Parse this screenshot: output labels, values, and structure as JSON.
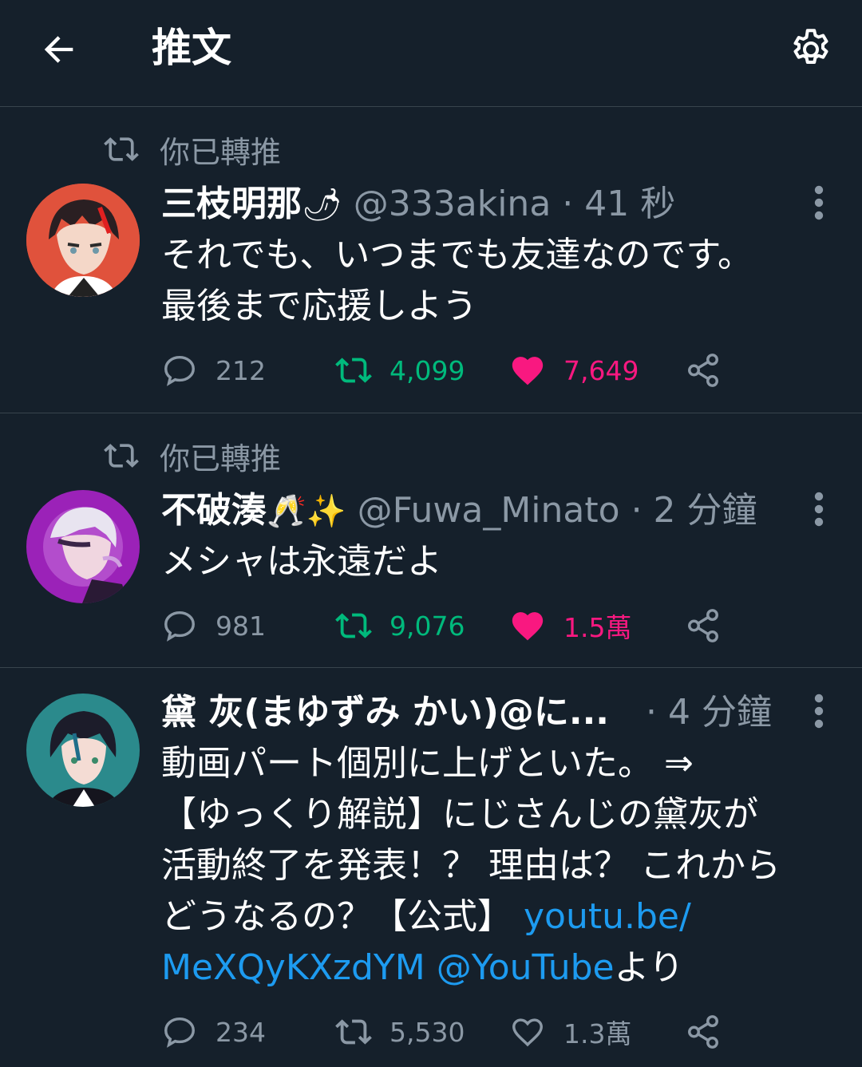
{
  "header": {
    "title": "推文"
  },
  "tweets": [
    {
      "retweet_label": "你已轉推",
      "name": "三枝明那",
      "emoji": "🌶",
      "handle": "@333akina",
      "time": "· 41 秒",
      "text": "それでも、いつまでも友達なのです。\n最後まで応援しよう",
      "replies": "212",
      "retweets": "4,099",
      "likes": "7,649",
      "retweeted": true,
      "liked": true
    },
    {
      "retweet_label": "你已轉推",
      "name": "不破湊",
      "emoji": "🥂✨",
      "handle": "@Fuwa_Minato",
      "time": "· 2 分鐘",
      "text": "メシャは永遠だよ",
      "replies": "981",
      "retweets": "9,076",
      "likes": "1.5萬",
      "retweeted": true,
      "liked": true
    },
    {
      "name": "黛 灰(まゆずみ かい)@に...",
      "time": "· 4 分鐘",
      "text_before": "動画パート個別に上げといた。 ⇒\n【ゆっくり解説】にじさんじの黛灰が\n活動終了を発表！？ 理由は？ これから\nどうなるの？【公式】 ",
      "link1": "youtu.be/\nMeXQyKXzdYM",
      "mention": " @YouTube",
      "text_after": "より",
      "replies": "234",
      "retweets": "5,530",
      "likes": "1.3萬",
      "retweeted": false,
      "liked": false
    }
  ],
  "colors": {
    "background": "#15202b",
    "divider": "#38444d",
    "secondary_text": "#8b98a5",
    "retweet_green": "#00ba7c",
    "like_pink": "#f91880",
    "link_blue": "#1d9bf0"
  }
}
